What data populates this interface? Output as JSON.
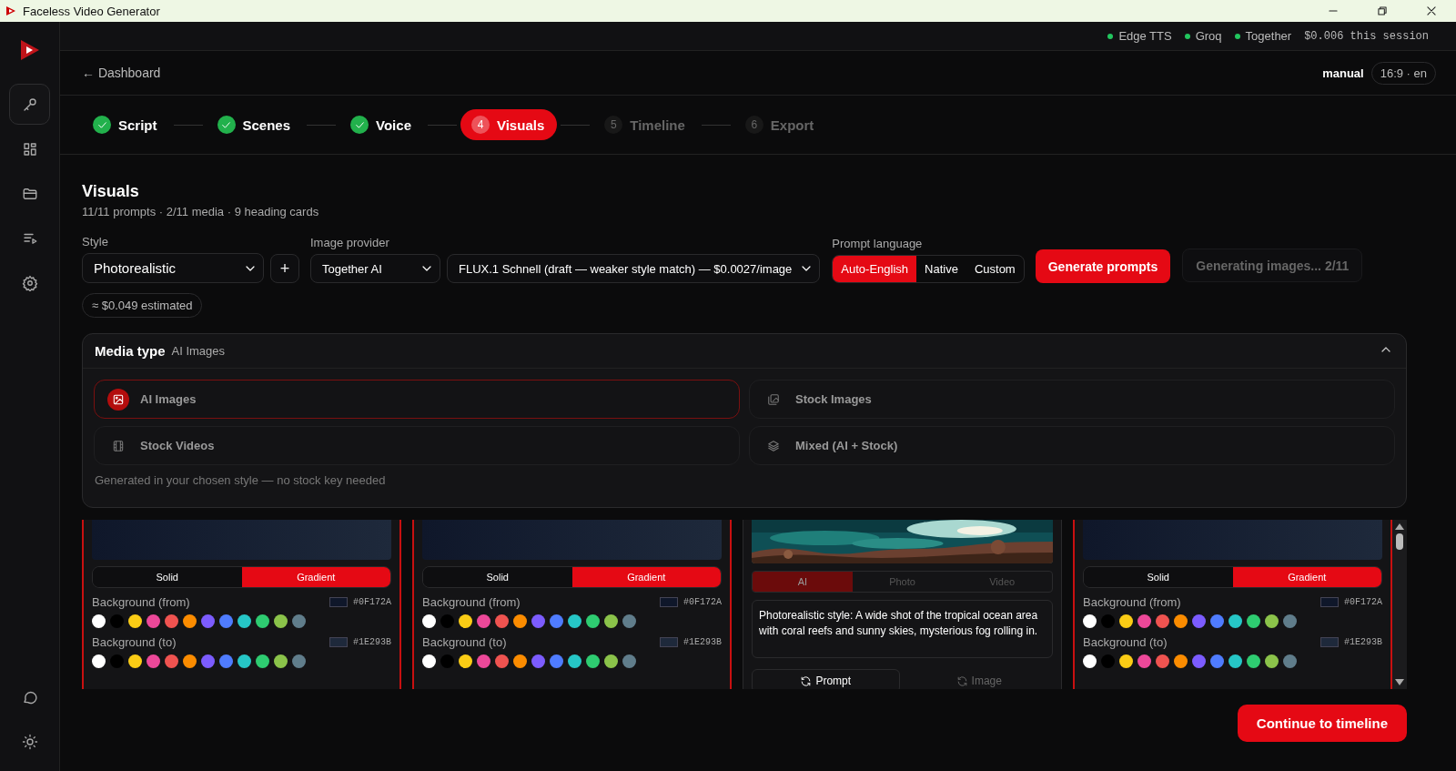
{
  "window": {
    "title": "Faceless Video Generator"
  },
  "sidebar": {
    "items": [
      {
        "selected": true
      },
      {
        "selected": false
      },
      {
        "selected": false
      },
      {
        "selected": false
      },
      {
        "selected": false
      }
    ],
    "bottom_items": [
      {
        "selected": false
      },
      {
        "selected": false
      }
    ]
  },
  "status_bar": {
    "services": [
      {
        "name": "Edge TTS",
        "color": "#22c55e"
      },
      {
        "name": "Groq",
        "color": "#22c55e"
      },
      {
        "name": "Together",
        "color": "#22c55e"
      }
    ],
    "session_cost": "$0.006 this session"
  },
  "header": {
    "back_link": "← Dashboard",
    "mode": "manual",
    "format": "16:9 · en"
  },
  "steps": [
    {
      "label": "Script",
      "completed": true,
      "selected": false
    },
    {
      "label": "Scenes",
      "completed": true,
      "selected": false
    },
    {
      "label": "Voice",
      "completed": true,
      "selected": false
    },
    {
      "label": "Visuals",
      "number": "4",
      "completed": false,
      "selected": true
    },
    {
      "label": "Timeline",
      "number": "5",
      "completed": false,
      "selected": false
    },
    {
      "label": "Export",
      "number": "6",
      "completed": false,
      "selected": false
    }
  ],
  "page": {
    "title": "Visuals",
    "subtitle": "11/11 prompts · 2/11 media · 9 heading cards"
  },
  "controls": {
    "style_label": "Style",
    "style_value": "Photorealistic",
    "add_button": "+",
    "provider_label": "Image provider",
    "provider_value": "Together AI",
    "model_value": "FLUX.1 Schnell (draft — weaker style match) — $0.0027/image",
    "language_label": "Prompt language",
    "languages": [
      {
        "label": "Auto-English",
        "selected": true
      },
      {
        "label": "Native",
        "selected": false
      },
      {
        "label": "Custom",
        "selected": false
      }
    ],
    "generate_button": "Generate prompts",
    "progress_button": {
      "label": "Generating images... 2/11",
      "disabled": true
    },
    "estimate": "≈ $0.049 estimated"
  },
  "media_type": {
    "title": "Media type",
    "current": "AI Images",
    "expanded": true,
    "options": [
      {
        "label": "AI Images",
        "selected": true
      },
      {
        "label": "Stock Images",
        "selected": false
      },
      {
        "label": "Stock Videos",
        "selected": false
      },
      {
        "label": "Mixed (AI + Stock)",
        "selected": false
      }
    ],
    "hint": "Generated in your chosen style — no stock key needed"
  },
  "cards": [
    {
      "kind": "background",
      "highlighted": true,
      "modes": [
        {
          "label": "Solid",
          "selected": false
        },
        {
          "label": "Gradient",
          "selected": true
        }
      ],
      "rows": [
        {
          "label": "Background (from)",
          "value": "#0F172A",
          "color": "#0f172a",
          "swatches": [
            {
              "color": "#ffffff"
            },
            {
              "color": "#000000"
            },
            {
              "color": "#facc15"
            },
            {
              "color": "#ec4899"
            },
            {
              "color": "#ef5350"
            },
            {
              "color": "#fb8c00"
            },
            {
              "color": "#7c5cff"
            },
            {
              "color": "#4f7cff"
            },
            {
              "color": "#26c6c6"
            },
            {
              "color": "#2ecc71"
            },
            {
              "color": "#8bc34a"
            },
            {
              "color": "#607d8b"
            }
          ]
        },
        {
          "label": "Background (to)",
          "value": "#1E293B",
          "color": "#1e293b",
          "swatches": [
            {
              "color": "#ffffff"
            },
            {
              "color": "#000000"
            },
            {
              "color": "#facc15"
            },
            {
              "color": "#ec4899"
            },
            {
              "color": "#ef5350"
            },
            {
              "color": "#fb8c00"
            },
            {
              "color": "#7c5cff"
            },
            {
              "color": "#4f7cff"
            },
            {
              "color": "#26c6c6"
            },
            {
              "color": "#2ecc71"
            },
            {
              "color": "#8bc34a"
            },
            {
              "color": "#607d8b"
            }
          ]
        }
      ]
    },
    {
      "kind": "background",
      "highlighted": true,
      "modes": [
        {
          "label": "Solid",
          "selected": false
        },
        {
          "label": "Gradient",
          "selected": true
        }
      ],
      "rows": [
        {
          "label": "Background (from)",
          "value": "#0F172A",
          "color": "#0f172a",
          "swatches": [
            {
              "color": "#ffffff"
            },
            {
              "color": "#000000"
            },
            {
              "color": "#facc15"
            },
            {
              "color": "#ec4899"
            },
            {
              "color": "#ef5350"
            },
            {
              "color": "#fb8c00"
            },
            {
              "color": "#7c5cff"
            },
            {
              "color": "#4f7cff"
            },
            {
              "color": "#26c6c6"
            },
            {
              "color": "#2ecc71"
            },
            {
              "color": "#8bc34a"
            },
            {
              "color": "#607d8b"
            }
          ]
        },
        {
          "label": "Background (to)",
          "value": "#1E293B",
          "color": "#1e293b",
          "swatches": [
            {
              "color": "#ffffff"
            },
            {
              "color": "#000000"
            },
            {
              "color": "#facc15"
            },
            {
              "color": "#ec4899"
            },
            {
              "color": "#ef5350"
            },
            {
              "color": "#fb8c00"
            },
            {
              "color": "#7c5cff"
            },
            {
              "color": "#4f7cff"
            },
            {
              "color": "#26c6c6"
            },
            {
              "color": "#2ecc71"
            },
            {
              "color": "#8bc34a"
            },
            {
              "color": "#607d8b"
            }
          ]
        }
      ]
    },
    {
      "kind": "media",
      "highlighted": false,
      "tabs": [
        {
          "label": "AI",
          "selected": true
        },
        {
          "label": "Photo",
          "selected": false
        },
        {
          "label": "Video",
          "selected": false
        }
      ],
      "prompt": "Photorealistic style: A wide shot of the tropical ocean area with coral reefs and sunny skies, mysterious fog rolling in.",
      "actions": [
        {
          "label": "Prompt",
          "disabled": false
        },
        {
          "label": "Image",
          "disabled": true
        }
      ]
    },
    {
      "kind": "background",
      "highlighted": true,
      "modes": [
        {
          "label": "Solid",
          "selected": false
        },
        {
          "label": "Gradient",
          "selected": true
        }
      ],
      "rows": [
        {
          "label": "Background (from)",
          "value": "#0F172A",
          "color": "#0f172a",
          "swatches": [
            {
              "color": "#ffffff"
            },
            {
              "color": "#000000"
            },
            {
              "color": "#facc15"
            },
            {
              "color": "#ec4899"
            },
            {
              "color": "#ef5350"
            },
            {
              "color": "#fb8c00"
            },
            {
              "color": "#7c5cff"
            },
            {
              "color": "#4f7cff"
            },
            {
              "color": "#26c6c6"
            },
            {
              "color": "#2ecc71"
            },
            {
              "color": "#8bc34a"
            },
            {
              "color": "#607d8b"
            }
          ]
        },
        {
          "label": "Background (to)",
          "value": "#1E293B",
          "color": "#1e293b",
          "swatches": [
            {
              "color": "#ffffff"
            },
            {
              "color": "#000000"
            },
            {
              "color": "#facc15"
            },
            {
              "color": "#ec4899"
            },
            {
              "color": "#ef5350"
            },
            {
              "color": "#fb8c00"
            },
            {
              "color": "#7c5cff"
            },
            {
              "color": "#4f7cff"
            },
            {
              "color": "#26c6c6"
            },
            {
              "color": "#2ecc71"
            },
            {
              "color": "#8bc34a"
            },
            {
              "color": "#607d8b"
            }
          ]
        }
      ]
    }
  ],
  "continue_button": "Continue to timeline"
}
